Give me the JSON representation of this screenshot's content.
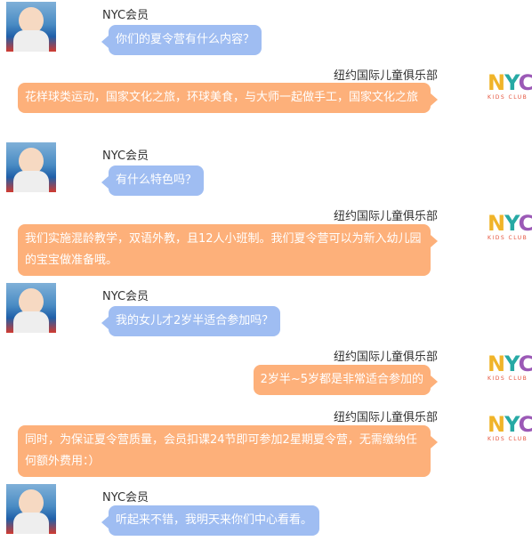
{
  "chat": {
    "member_name": "NYC会员",
    "club_name": "纽约国际儿童俱乐部",
    "logo": {
      "text_n": "N",
      "text_y": "Y",
      "text_c": "C",
      "sub": "KIDS CLUB"
    },
    "messages": [
      {
        "from": "member",
        "text": "你们的夏令营有什么内容？"
      },
      {
        "from": "club",
        "text": "花样球类运动，国家文化之旅，环球美食，与大师一起做手工，国家文化之旅"
      },
      {
        "from": "member",
        "text": "有什么特色吗？"
      },
      {
        "from": "club",
        "text": "我们实施混龄教学，双语外教，且12人小班制。我们夏令营可以为新入幼儿园的宝宝做准备哦。"
      },
      {
        "from": "member",
        "text": "我的女儿才2岁半适合参加吗？"
      },
      {
        "from": "club",
        "text": "2岁半~5岁都是非常适合参加的"
      },
      {
        "from": "club",
        "text": "同时，为保证夏令营质量，会员扣课24节即可参加2星期夏令营，无需缴纳任何额外费用：）"
      },
      {
        "from": "member",
        "text": "听起来不错，我明天来你们中心看看。"
      }
    ]
  },
  "colors": {
    "member_bubble": "#9fbdf2",
    "club_bubble": "#fdb07a"
  }
}
